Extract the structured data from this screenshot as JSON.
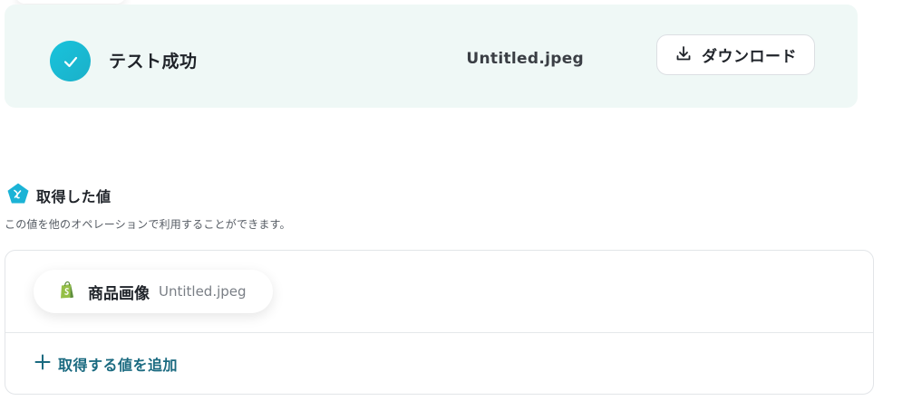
{
  "banner": {
    "status_text": "テスト成功",
    "file_name": "Untitled.jpeg",
    "download_label": "ダウンロード",
    "accent_color": "#19c3dc"
  },
  "section": {
    "title": "取得した値",
    "description": "この値を他のオペレーションで利用することができます。"
  },
  "values": [
    {
      "label": "商品画像",
      "value": "Untitled.jpeg",
      "icon": "shopify-icon"
    }
  ],
  "add_value_label": "取得する値を追加",
  "link_color": "#1a6a80"
}
